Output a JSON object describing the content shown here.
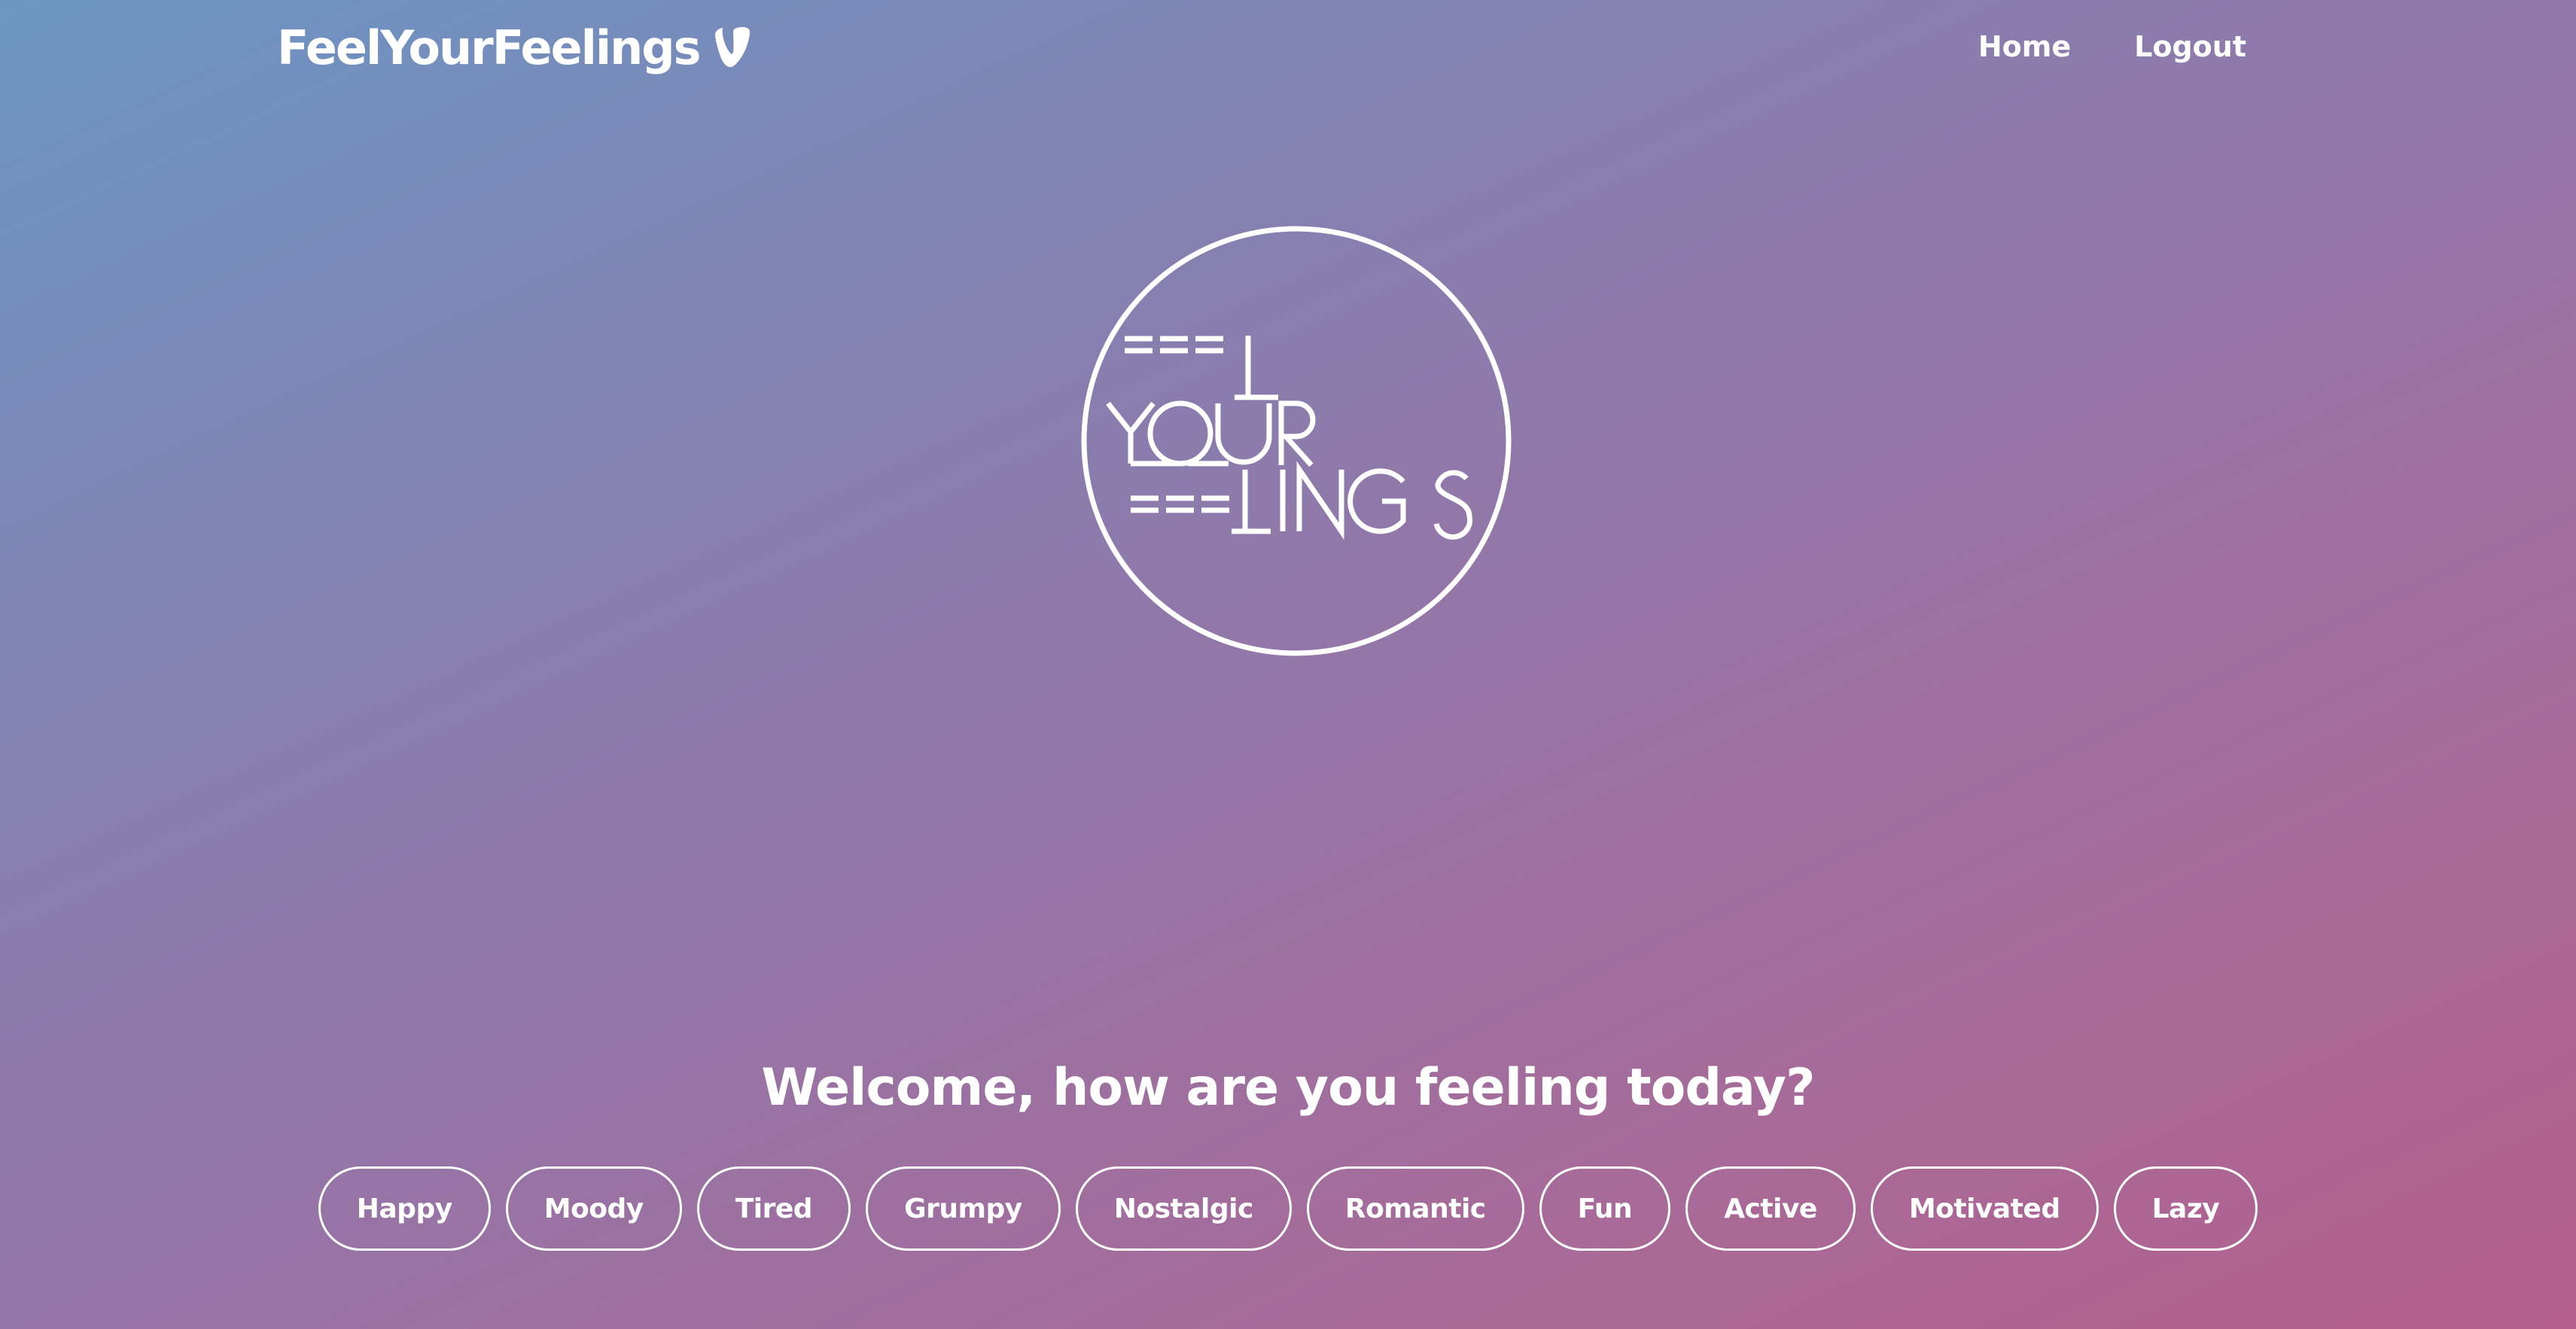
{
  "nav": {
    "brand_label": "FeelYourFeelings",
    "brand_icon": "typo3-icon",
    "links": [
      {
        "label": "Home"
      },
      {
        "label": "Logout"
      }
    ]
  },
  "hero": {
    "logo_text": [
      "FEEL",
      "YOUR",
      "FEELINGS"
    ],
    "welcome_text": "Welcome, how are you feeling today?"
  },
  "moods": [
    {
      "label": "Happy"
    },
    {
      "label": "Moody"
    },
    {
      "label": "Tired"
    },
    {
      "label": "Grumpy"
    },
    {
      "label": "Nostalgic"
    },
    {
      "label": "Romantic"
    },
    {
      "label": "Fun"
    },
    {
      "label": "Active"
    },
    {
      "label": "Motivated"
    },
    {
      "label": "Lazy"
    }
  ],
  "colors": {
    "gradient_start": "#6b96c4",
    "gradient_end": "#b45f8d",
    "text": "#ffffff"
  }
}
